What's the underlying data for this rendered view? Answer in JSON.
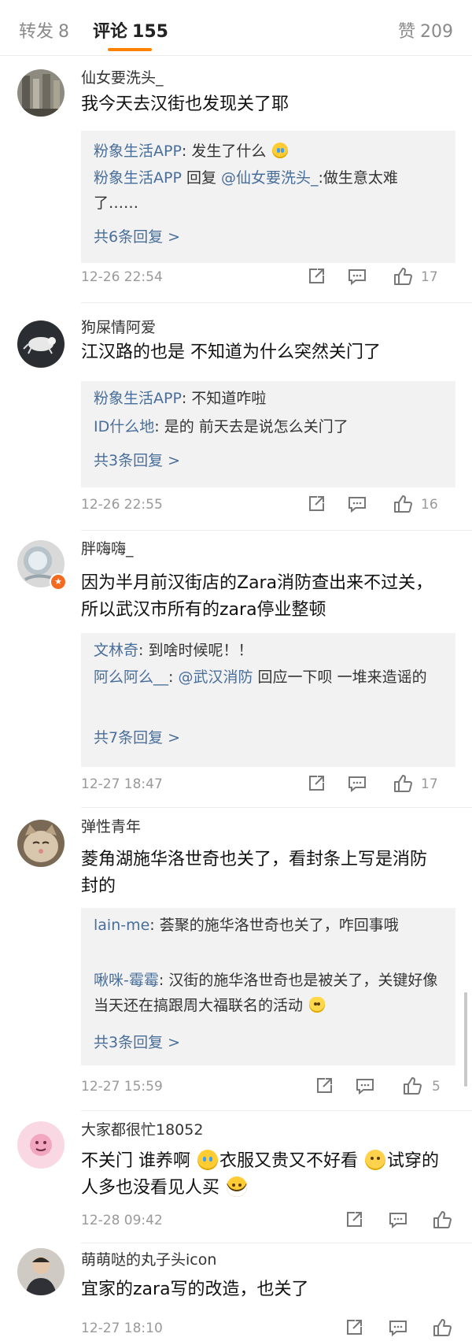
{
  "tabs": {
    "repost": {
      "label": "转发",
      "count": "8"
    },
    "comments": {
      "label": "评论",
      "count": "155"
    },
    "likes": {
      "label": "赞",
      "count": "209"
    }
  },
  "comments": [
    {
      "username": "仙女要洗头_",
      "text": "我今天去汉街也发现关了耶",
      "replies": [
        {
          "name": "粉象生活APP",
          "sep": ": ",
          "text": "发生了什么 "
        },
        {
          "name": "粉象生活APP",
          "sep": " 回复 ",
          "mention": "@仙女要洗头_",
          "text": ":做生意太难了……"
        }
      ],
      "more": "共6条回复 >",
      "time": "12-26 22:54",
      "likes": "17"
    },
    {
      "username": "狗屎情阿爱",
      "text": "江汉路的也是 不知道为什么突然关门了",
      "replies": [
        {
          "name": "粉象生活APP",
          "sep": ": ",
          "text": "不知道咋啦"
        },
        {
          "name": "ID什么地",
          "sep": ": ",
          "text": "是的 前天去是说怎么关门了"
        }
      ],
      "more": "共3条回复 >",
      "time": "12-26 22:55",
      "likes": "16"
    },
    {
      "username": "胖嗨嗨_",
      "text": "因为半月前汉街店的Zara消防查出来不过关，所以武汉市所有的zara停业整顿",
      "replies": [
        {
          "name": "文林奇",
          "sep": ": ",
          "text": "到啥时候呢！！"
        },
        {
          "name": "阿么阿么__",
          "sep": ": ",
          "mention": "@武汉消防",
          "text": " 回应一下呗 一堆来造谣的"
        }
      ],
      "more": "共7条回复 >",
      "time": "12-27 18:47",
      "likes": "17"
    },
    {
      "username": "弹性青年",
      "text": "菱角湖施华洛世奇也关了，看封条上写是消防封的",
      "replies": [
        {
          "name": "lain-me",
          "sep": ": ",
          "text": "荟聚的施华洛世奇也关了，咋回事哦"
        },
        {
          "name": "啾咪-霉霉",
          "sep": ": ",
          "text": "汉街的施华洛世奇也是被关了，关键好像当天还在搞跟周大福联名的活动 "
        }
      ],
      "more": "共3条回复 >",
      "time": "12-27 15:59",
      "likes": "5"
    },
    {
      "username": "大家都很忙18052",
      "text_parts": [
        "不关门 谁养啊 ",
        "衣服又贵又不好看 ",
        "试穿的人多也没看见人买 "
      ],
      "time": "12-28 09:42",
      "likes": ""
    },
    {
      "username": "萌萌哒的丸子头icon",
      "text": "宜家的zara写的改造，也关了",
      "time": "12-27 18:10",
      "likes": ""
    }
  ],
  "icons": {
    "share": "share-icon",
    "comment": "comment-icon",
    "like": "thumbs-up-icon"
  },
  "colors": {
    "accent": "#ff8200",
    "link": "#486e9b",
    "reply_bg": "#f2f2f2",
    "muted": "#999999"
  }
}
